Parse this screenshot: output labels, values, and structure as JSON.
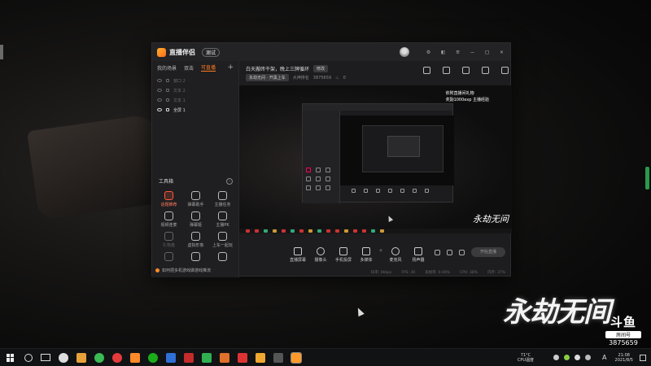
{
  "app": {
    "name": "直播伴侣",
    "beta": "测试",
    "tabs": [
      "我的场景",
      "双击",
      "可直播"
    ],
    "active_tab_index": 2,
    "scenes": [
      "窗口 2",
      "文本 2",
      "文本 1",
      "全屏 1"
    ],
    "toolbox_title": "工具箱",
    "tools": [
      {
        "label": "话题推荐",
        "hot": true
      },
      {
        "label": "弹幕助手",
        "hot": false
      },
      {
        "label": "主播任务",
        "hot": false
      },
      {
        "label": "视频连麦",
        "hot": false
      },
      {
        "label": "弹幕姬",
        "hot": false
      },
      {
        "label": "主播PK",
        "hot": false
      },
      {
        "label": "礼物盘",
        "hot": false,
        "dim": true
      },
      {
        "label": "虚拟形象",
        "hot": false
      },
      {
        "label": "上车一起玩",
        "hot": false
      },
      {
        "label": "",
        "hot": false,
        "dim": true
      },
      {
        "label": "",
        "hot": false
      },
      {
        "label": "",
        "hot": false
      }
    ],
    "tip": "如何把多机游戏做游戏推流"
  },
  "room": {
    "title": "白天搬砖干架，晚上三牌循环",
    "edit_label": "修改",
    "category": "永劫无间 · 开黑上车",
    "meta_label": "大神排名",
    "id_display": "3875659",
    "fans": "0"
  },
  "preview": {
    "overlay_line1": "依附直播间礼物",
    "overlay_line2": "奖励1000exp 主播经验",
    "brand_small": "永劫无间"
  },
  "controls": [
    {
      "label": "直播屏幕",
      "icon": "screen-icon"
    },
    {
      "label": "摄像头",
      "icon": "camera-icon",
      "round": true
    },
    {
      "label": "手机投屏",
      "icon": "phone-cast-icon"
    },
    {
      "label": "多媒体",
      "icon": "media-icon"
    },
    {
      "label": "麦克风",
      "icon": "mic-icon"
    },
    {
      "label": "扬声器",
      "icon": "speaker-icon"
    }
  ],
  "start_button": "开始直播",
  "status": [
    "码率: 0kbps",
    "FPS: 30",
    "丢帧率: 0.00%",
    "CPU: 38%",
    "内存: 37%"
  ],
  "desktop": {
    "big_brand": "永劫无间",
    "douyu": "斗鱼",
    "room_label": "房间号",
    "room_id": "3875659"
  },
  "taskbar": {
    "temp": "71°C",
    "cpu_label": "CPU温度",
    "ime": "A",
    "time": "21:08",
    "date": "2021/8/5"
  },
  "colors": {
    "accent": "#ff7a1f",
    "hot": "#ff5a3c"
  }
}
